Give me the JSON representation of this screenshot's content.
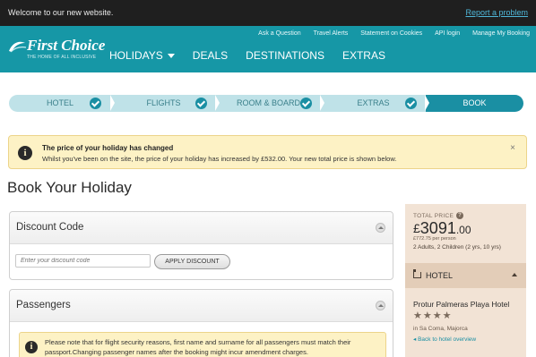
{
  "topbar": {
    "welcome": "Welcome to our new website.",
    "report": "Report a problem"
  },
  "header": {
    "brand": "First Choice",
    "tagline": "THE HOME OF ALL INCLUSIVE",
    "util_links": [
      "Ask a Question",
      "Travel Alerts",
      "Statement on Cookies",
      "API login",
      "Manage My Booking"
    ],
    "nav": [
      "HOLIDAYS",
      "DEALS",
      "DESTINATIONS",
      "EXTRAS"
    ]
  },
  "steps": [
    {
      "label": "HOTEL",
      "completed": true
    },
    {
      "label": "FLIGHTS",
      "completed": true
    },
    {
      "label": "ROOM & BOARD",
      "completed": true
    },
    {
      "label": "EXTRAS",
      "completed": true
    },
    {
      "label": "BOOK",
      "completed": false,
      "active": true
    }
  ],
  "alert": {
    "title": "The price of your holiday has changed",
    "message": "Whilst you've been on the site, the price of your holiday has increased by £532.00. Your new total price is shown below.",
    "close": "×"
  },
  "page_title": "Book Your Holiday",
  "discount": {
    "title": "Discount Code",
    "placeholder": "Enter your discount code",
    "button": "APPLY DISCOUNT"
  },
  "passengers": {
    "title": "Passengers",
    "note": "Please note that for flight security reasons, first name and surname for all passengers must match their passport.Changing passenger names after the booking might incur amendment charges."
  },
  "summary": {
    "total_label": "TOTAL PRICE",
    "help": "?",
    "currency": "£",
    "price_whole": "3091",
    "price_decimal": ".00",
    "per_person": "£772.75 per person",
    "party": "2 Adults, 2 Children (2 yrs, 10 yrs)",
    "hotel_label": "HOTEL",
    "hotel_name": "Protur Palmeras Playa Hotel",
    "stars": "★★★★",
    "star_rating": 4,
    "location": "in Sa Coma, Majorca",
    "back_link": "◂ Back to hotel overview"
  },
  "colors": {
    "brand_teal": "#1697a6",
    "step_active": "#1a8fa3",
    "step_inactive": "#bfe2e8",
    "alert_bg": "#fdf2c5",
    "sidebar_bg": "#f2e3d5"
  }
}
